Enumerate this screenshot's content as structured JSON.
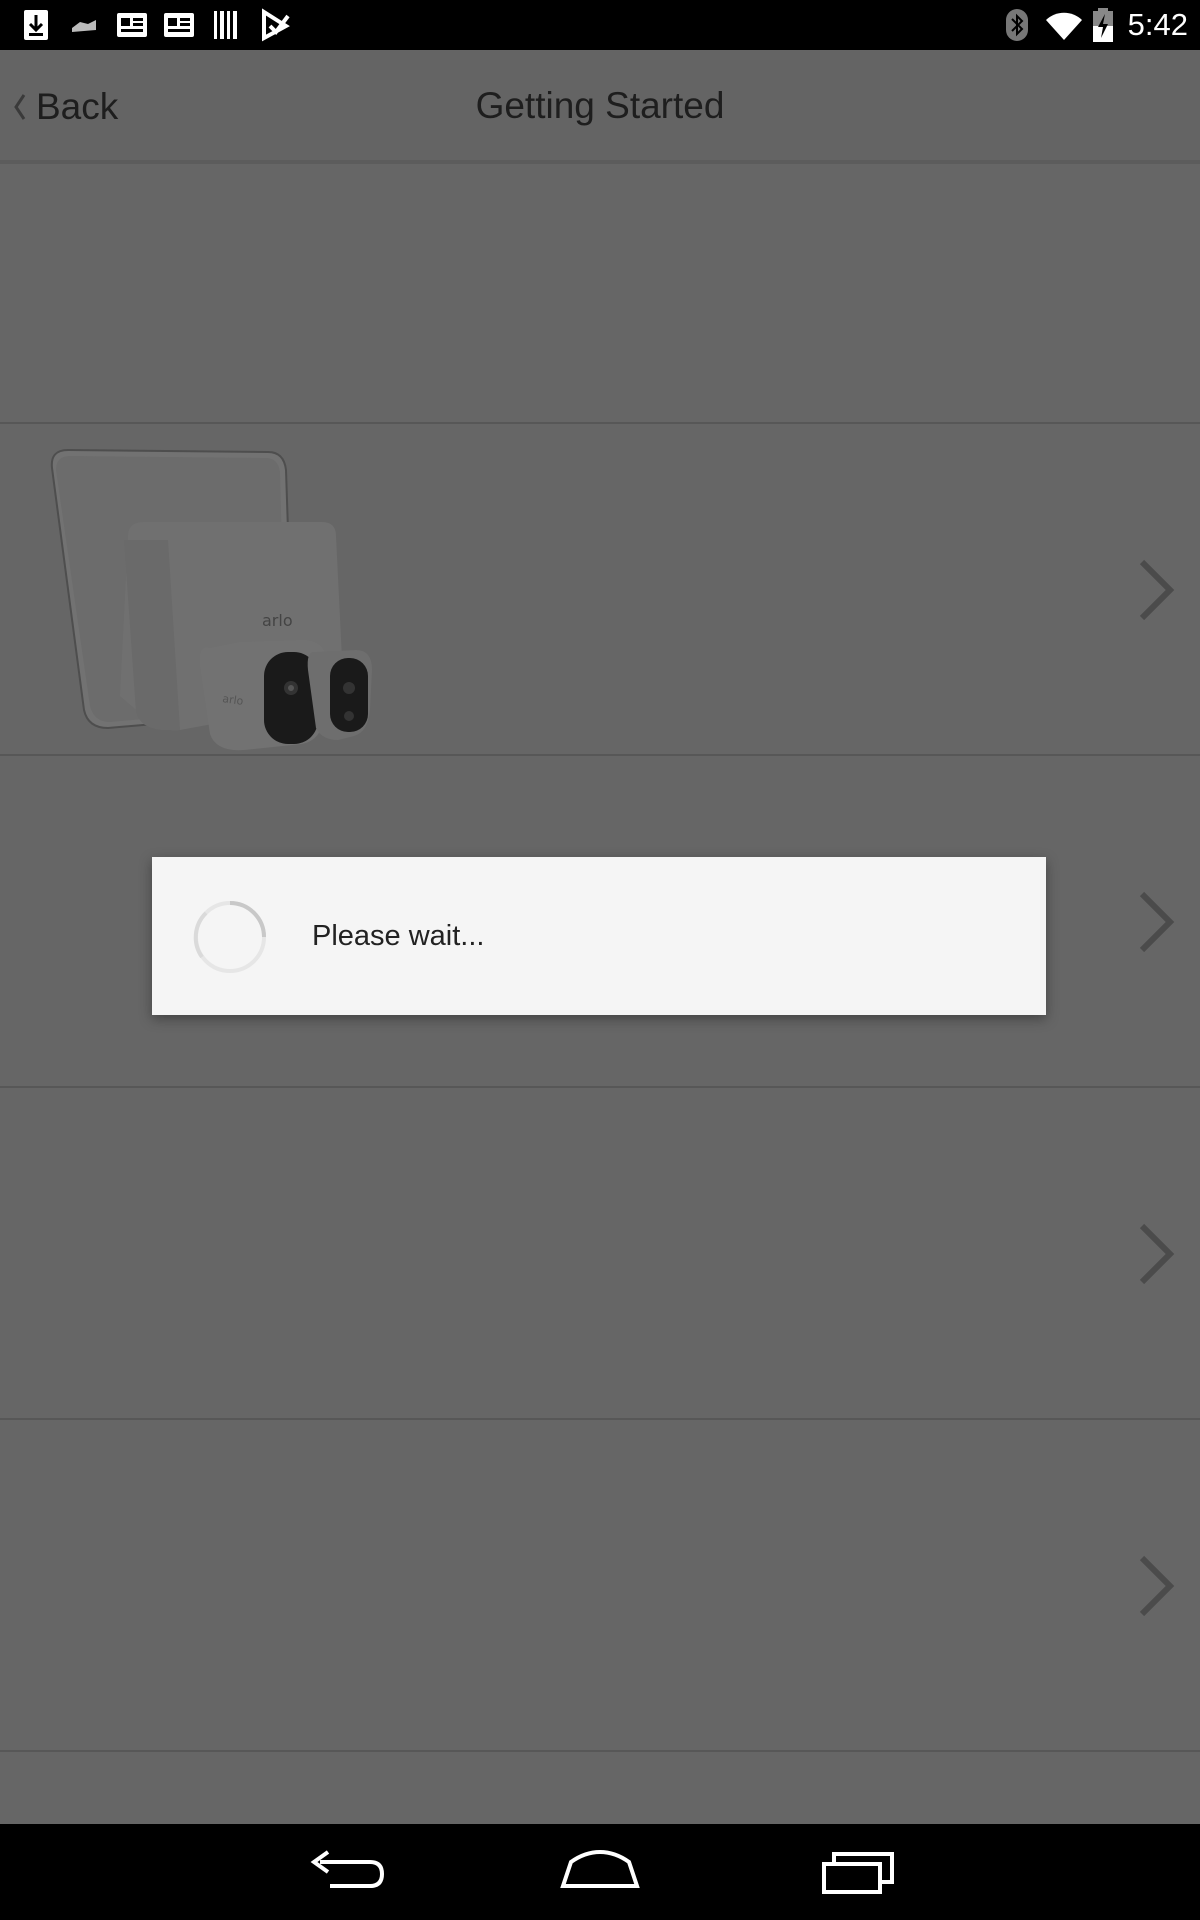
{
  "status_bar": {
    "time": "5:42",
    "left_icons": [
      "download-icon",
      "ticket-icon",
      "news-icon",
      "news-icon",
      "barcode-icon",
      "check-task-icon"
    ],
    "right_icons": [
      "bluetooth-icon",
      "wifi-icon",
      "battery-charging-icon"
    ]
  },
  "header": {
    "back_label": "Back",
    "title": "Getting Started"
  },
  "product": {
    "logo_text_base": "arlo",
    "logo_text_camera": "arlo"
  },
  "dialog": {
    "message": "Please wait..."
  },
  "nav_bar": {
    "icons": [
      "back-icon",
      "home-icon",
      "recents-icon"
    ]
  }
}
